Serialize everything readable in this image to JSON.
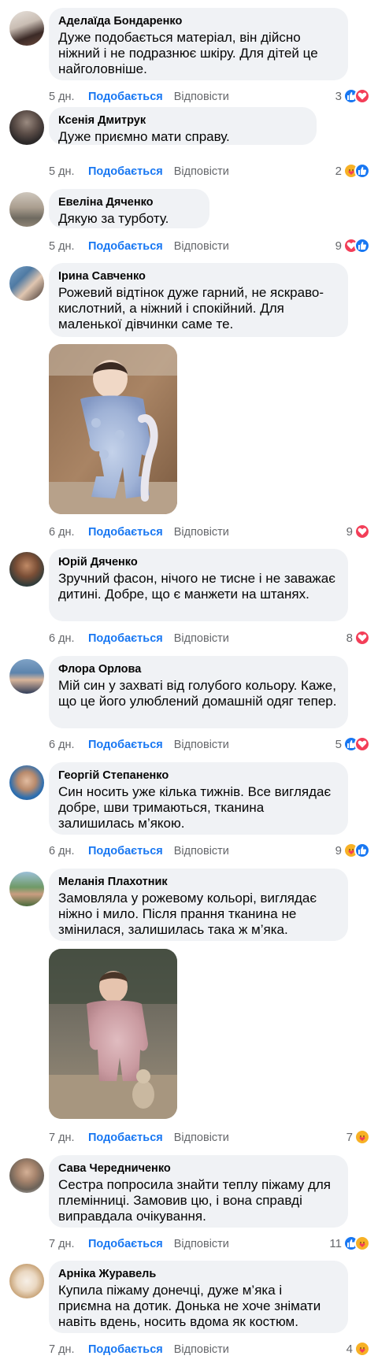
{
  "ui": {
    "like_label": "Подобається",
    "reply_label": "Відповісти"
  },
  "comments": [
    {
      "author": "Аделаїда Бондаренко",
      "text": "Дуже подобається матеріал, він дійсно ніжний і не подразнює шкіру. Для дітей це найголовніше.",
      "time": "5 дн.",
      "reactions": "3",
      "icons": [
        "like-icon",
        "heart-icon"
      ]
    },
    {
      "author": "Ксенія Дмитрук",
      "text": "Дуже приємно мати справу.",
      "time": "5 дн.",
      "reactions": "2",
      "icons": [
        "care-icon",
        "like-icon"
      ]
    },
    {
      "author": "Евеліна Дяченко",
      "text": "Дякую за турботу.",
      "time": "5 дн.",
      "reactions": "9",
      "icons": [
        "heart-icon",
        "like-icon"
      ]
    },
    {
      "author": "Ірина Савченко",
      "text": "Рожевий відтінок дуже гарний, не яскраво-кислотний, а ніжний і спокійний. Для маленької дівчинки саме те.",
      "time": "6 дн.",
      "reactions": "9",
      "icons": [
        "heart-icon"
      ]
    },
    {
      "author": "Юрій Дяченко",
      "text": "Зручний фасон, нічого не тисне і не заважає дитині. Добре, що є манжети на штанях.",
      "time": "6 дн.",
      "reactions": "8",
      "icons": [
        "heart-icon"
      ]
    },
    {
      "author": "Флора Орлова",
      "text": "Мій син у захваті від голубого кольору. Каже, що це його улюблений домашній одяг тепер.",
      "time": "6 дн.",
      "reactions": "5",
      "icons": [
        "like-icon",
        "heart-icon"
      ]
    },
    {
      "author": "Георгій Степаненко",
      "text": "Син носить уже кілька тижнів. Все виглядає добре, шви тримаються, тканина залишилась м’якою.",
      "time": "6 дн.",
      "reactions": "9",
      "icons": [
        "care-icon",
        "like-icon"
      ]
    },
    {
      "author": "Меланія Плахотник",
      "text": "Замовляла у рожевому кольорі, виглядає ніжно і мило. Після прання тканина не змінилася, залишилась така ж м’яка.",
      "time": "7 дн.",
      "reactions": "7",
      "icons": [
        "care-icon"
      ]
    },
    {
      "author": "Сава Чередниченко",
      "text": "Сестра попросила знайти теплу піжаму для племінниці. Замовив цю, і вона справді виправдала очікування.",
      "time": "7 дн.",
      "reactions": "11",
      "icons": [
        "like-icon",
        "care-icon"
      ]
    },
    {
      "author": "Арніка Журавель",
      "text": "Купила піжаму донечці, дуже м’яка і приємна на дотик. Донька не хоче знімати навіть вдень, носить вдома як костюм.",
      "time": "7 дн.",
      "reactions": "4",
      "icons": [
        "care-icon"
      ]
    }
  ],
  "colors": {
    "link": "#1877f2",
    "meta": "#65676b",
    "bubble": "#f0f2f5",
    "like": "#1877f2",
    "heart": "#f33e58",
    "care": "#f7b125"
  }
}
